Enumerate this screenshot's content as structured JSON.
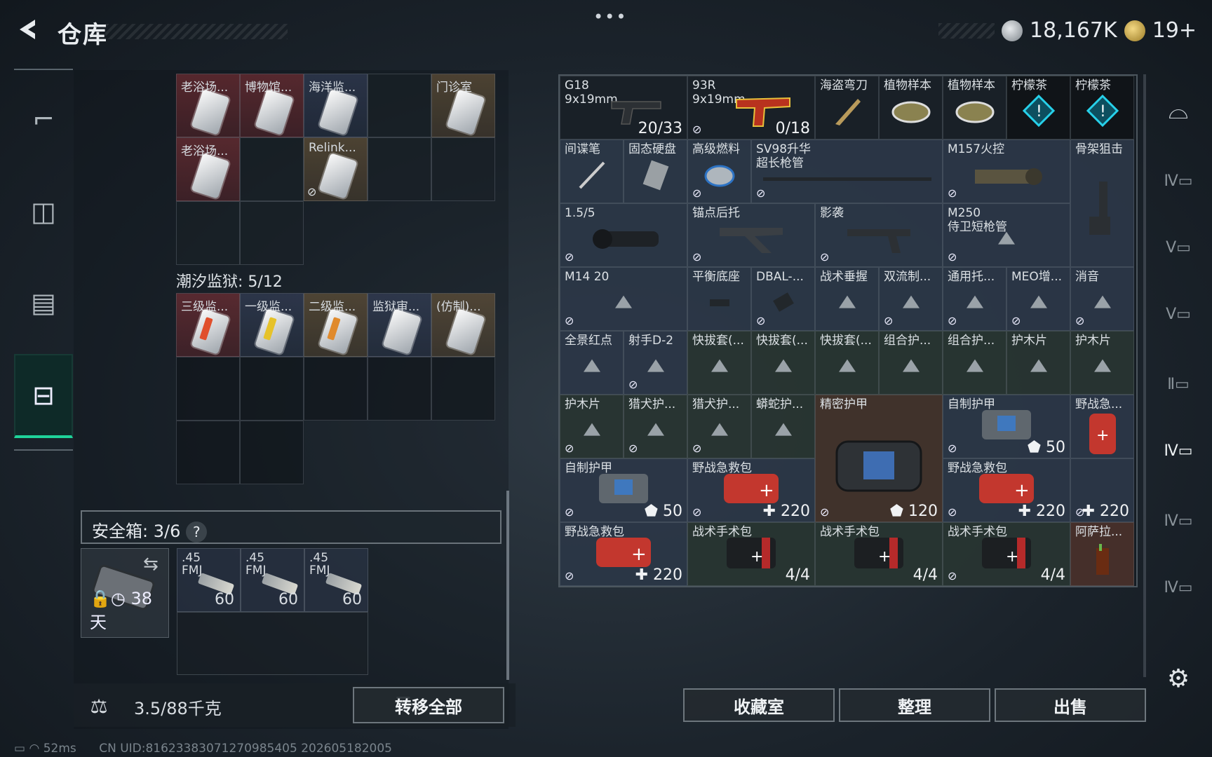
{
  "header": {
    "title": "仓库",
    "more": "•••",
    "currency_silver": "18,167K",
    "currency_gold": "19+"
  },
  "stash": {
    "row1": [
      "老浴场...",
      "博物馆...",
      "海洋监...",
      "",
      "门诊室"
    ],
    "row2": [
      "老浴场...",
      "",
      "Relink...",
      "",
      ""
    ],
    "section_label": "潮汐监狱: 5/12",
    "prison": [
      "三级监...",
      "一级监...",
      "二级监...",
      "监狱审...",
      "(仿制)..."
    ]
  },
  "safe": {
    "label": "安全箱: 3/6",
    "help": "?",
    "days": "38天",
    "ammo": [
      {
        "name": ".45\nFMJ",
        "count": "60"
      },
      {
        "name": ".45\nFMJ",
        "count": "60"
      },
      {
        "name": ".45\nFMJ",
        "count": "60"
      }
    ]
  },
  "bottom": {
    "weight": "3.5/88千克",
    "transfer_all": "转移全部",
    "collection": "收藏室",
    "organize": "整理",
    "sell": "出售"
  },
  "status": {
    "ping": "52ms",
    "uid": "CN UID:81623383071270985405 202605182005"
  },
  "inventory": {
    "g18_name": "G18\n9x19mm",
    "g18_count": "20/33",
    "r93_name": "93R\n9x19mm",
    "r93_count": "0/18",
    "pirate_knife": "海盗弯刀",
    "plant1": "植物样本",
    "plant2": "植物样本",
    "tea1": "柠檬茶",
    "tea2": "柠檬茶",
    "spy_pen": "间谍笔",
    "ssd": "固态硬盘",
    "fuel": "高级燃料",
    "sv98": "SV98升华\n超长枪管",
    "m157": "M157火控",
    "skeleton": "骨架狙击",
    "scope": "1.5/5",
    "anchor": "锚点后托",
    "shadow": "影袭",
    "m250": "M250\n侍卫短枪管",
    "m14": "M14 20",
    "balance": "平衡底座",
    "dbal": "DBAL-...",
    "grip": "战术垂握",
    "dual": "双流制...",
    "universal": "通用托...",
    "meo": "MEO增...",
    "silencer": "消音",
    "panorama": "全景红点",
    "shooter": "射手D-2",
    "quick1": "快拔套(...",
    "quick2": "快拔套(...",
    "quick3": "快拔套(...",
    "combo1": "组合护...",
    "combo2": "组合护...",
    "wood1": "护木片",
    "wood2": "护木片",
    "wood3": "护木片",
    "hound1": "猎犬护...",
    "hound2": "猎犬护...",
    "viper": "蟒蛇护...",
    "precise": "精密护甲",
    "precise_count": "120",
    "self_armor1": "自制护甲",
    "self_armor1_count": "50",
    "field1": "野战急...",
    "self_armor2": "自制护甲",
    "self_armor2_count": "50",
    "field2": "野战急救包",
    "field2_count": "220",
    "field3": "野战急救包",
    "field3_count": "220",
    "field4_count": "220",
    "field5": "野战急救包",
    "field5_count": "220",
    "tac1": "战术手术包",
    "tac1_count": "4/4",
    "tac2": "战术手术包",
    "tac2_count": "4/4",
    "tac3": "战术手术包",
    "tac3_count": "4/4",
    "asala": "阿萨拉..."
  },
  "colors": {
    "accent": "#1fd39a",
    "panel_border": "#4c565e"
  }
}
